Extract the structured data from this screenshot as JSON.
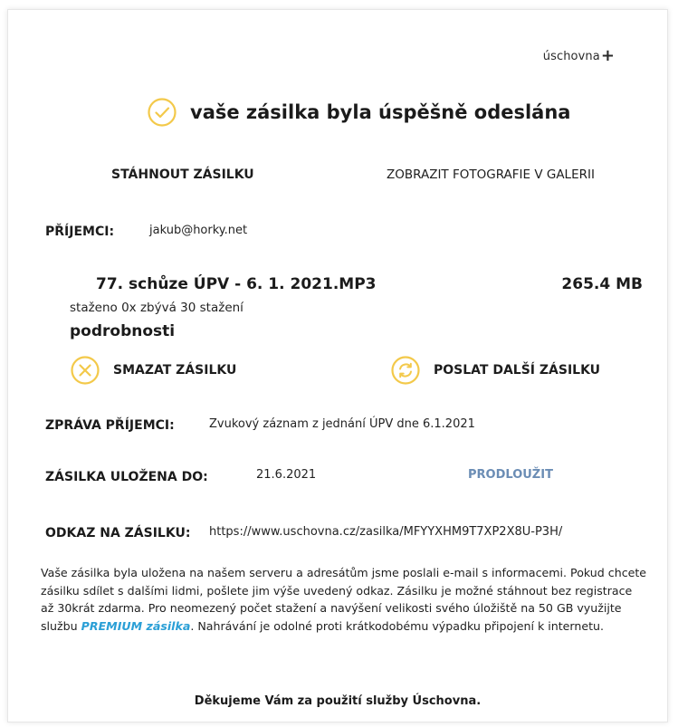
{
  "brand": {
    "name": "úschovna",
    "plus": "+"
  },
  "status": {
    "title": "vaše zásilka byla úspěšně odeslána"
  },
  "actions": {
    "download": "STÁHNOUT ZÁSILKU",
    "gallery": "ZOBRAZIT FOTOGRAFIE V GALERII",
    "delete": "SMAZAT ZÁSILKU",
    "send_another": "POSLAT DALŠÍ ZÁSILKU"
  },
  "recipients": {
    "label": "PŘÍJEMCI:",
    "value": "jakub@horky.net"
  },
  "file": {
    "name": "77. schůze ÚPV - 6. 1. 2021.MP3",
    "size": "265.4 MB",
    "download_info": "staženo 0x zbývá 30 stažení",
    "details_label": "podrobnosti"
  },
  "message": {
    "label": "ZPRÁVA PŘÍJEMCI:",
    "value": "Zvukový záznam z jednání ÚPV dne 6.1.2021"
  },
  "stored": {
    "label": "ZÁSILKA ULOŽENA DO:",
    "value": "21.6.2021",
    "extend_label": "PRODLOUŽIT"
  },
  "link": {
    "label": "ODKAZ NA ZÁSILKU:",
    "value": "https://www.uschovna.cz/zasilka/MFYYXHM9T7XP2X8U-P3H/"
  },
  "info": {
    "text_before": "Vaše zásilka byla uložena na našem serveru a adresátům jsme poslali e-mail s informacemi. Pokud chcete zásilku sdílet s dalšími lidmi, pošlete jim výše uvedený odkaz. Zásilku je možné stáhnout bez registrace až 30krát zdarma. Pro neomezený počet stažení a navýšení velikosti svého úložiště na 50 GB využijte službu ",
    "premium_label": "PREMIUM zásilka",
    "text_after": ". Nahrávání je odolné proti krátkodobému výpadku připojení k internetu."
  },
  "footer": {
    "thanks": "Děkujeme Vám za použití služby Úschovna."
  },
  "colors": {
    "accent_icon": "#f3c94a",
    "link_blue": "#6b8db5",
    "premium_blue": "#2a9fd6"
  },
  "icons": {
    "success": "check-circle-icon",
    "delete": "x-circle-icon",
    "send_another": "refresh-circle-icon"
  }
}
